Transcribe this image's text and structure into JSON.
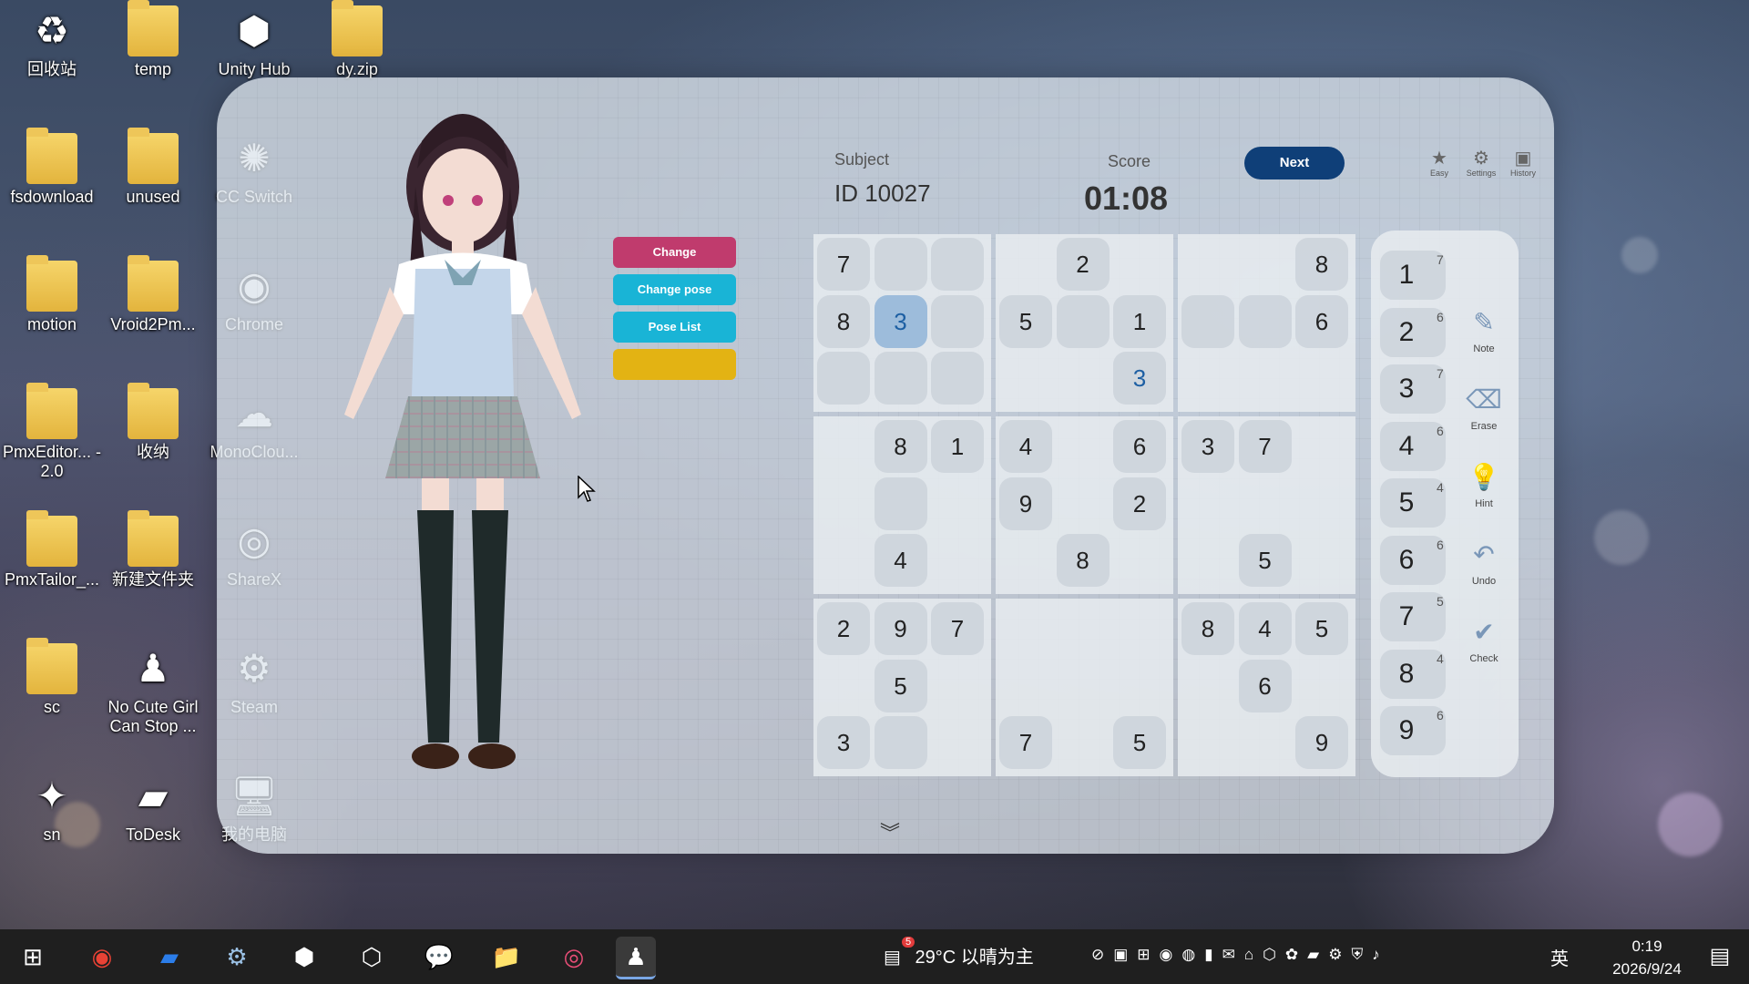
{
  "desktop": {
    "icons": [
      {
        "label": "回收站",
        "icon": "recycle-bin-icon",
        "glyph": "♻"
      },
      {
        "label": "temp",
        "icon": "folder-icon",
        "glyph": ""
      },
      {
        "label": "Unity Hub",
        "icon": "unity-hub-icon",
        "glyph": "⬢"
      },
      {
        "label": "dy.zip",
        "icon": "zip-icon",
        "glyph": ""
      },
      {
        "label": "fsdownload",
        "icon": "folder-icon",
        "glyph": ""
      },
      {
        "label": "unused",
        "icon": "folder-icon",
        "glyph": ""
      },
      {
        "label": "CC Switch",
        "icon": "cc-switch-icon",
        "glyph": "✺"
      },
      {
        "label": "motion",
        "icon": "folder-icon",
        "glyph": ""
      },
      {
        "label": "Vroid2Pm...",
        "icon": "folder-icon",
        "glyph": ""
      },
      {
        "label": "Chrome",
        "icon": "chrome-icon",
        "glyph": "◉"
      },
      {
        "label": "PmxEditor... - 2.0",
        "icon": "folder-icon",
        "glyph": ""
      },
      {
        "label": "收纳",
        "icon": "folder-icon",
        "glyph": ""
      },
      {
        "label": "MonoClou...",
        "icon": "monocloud-icon",
        "glyph": "☁"
      },
      {
        "label": "PmxTailor_...",
        "icon": "folder-icon",
        "glyph": ""
      },
      {
        "label": "新建文件夹",
        "icon": "folder-icon",
        "glyph": ""
      },
      {
        "label": "ShareX",
        "icon": "sharex-icon",
        "glyph": "◎"
      },
      {
        "label": "sc",
        "icon": "folder-icon",
        "glyph": ""
      },
      {
        "label": "No Cute Girl Can Stop ...",
        "icon": "game-icon",
        "glyph": "♟"
      },
      {
        "label": "Steam",
        "icon": "steam-icon",
        "glyph": "⚙"
      },
      {
        "label": "sn",
        "icon": "sn-icon",
        "glyph": "✦"
      },
      {
        "label": "ToDesk",
        "icon": "todesk-icon",
        "glyph": "▰"
      },
      {
        "label": "我的电脑",
        "icon": "computer-icon",
        "glyph": "🖥"
      }
    ]
  },
  "pose_menu": {
    "buttons": [
      {
        "label": "Change",
        "color": "#c03b6d"
      },
      {
        "label": "Change pose",
        "color": "#19b4d6"
      },
      {
        "label": "Pose List",
        "color": "#19b4d6"
      },
      {
        "label": "",
        "color": "#e3b313"
      }
    ]
  },
  "header": {
    "subject_label": "Subject",
    "subject_value": "ID 10027",
    "score_label": "Score",
    "score_value": "01:08",
    "next_label": "Next"
  },
  "top_tools": [
    {
      "label": "Easy",
      "icon": "star-icon"
    },
    {
      "label": "Settings",
      "icon": "gear-icon"
    },
    {
      "label": "History",
      "icon": "history-icon"
    }
  ],
  "grid": [
    [
      "7",
      "",
      "",
      "",
      "2",
      "",
      "",
      "",
      "8"
    ],
    [
      "8",
      "3",
      "",
      "5",
      "",
      "1",
      "",
      "",
      "6"
    ],
    [
      "",
      "",
      "",
      "",
      "",
      "3",
      "",
      "",
      ""
    ],
    [
      "",
      "8",
      "1",
      "4",
      "",
      "6",
      "3",
      "7",
      ""
    ],
    [
      "",
      "",
      "",
      "9",
      "",
      "2",
      "",
      "",
      ""
    ],
    [
      "",
      "4",
      "",
      "",
      "8",
      "",
      "",
      "5",
      ""
    ],
    [
      "2",
      "9",
      "7",
      "",
      "",
      "",
      "8",
      "4",
      "5"
    ],
    [
      "",
      "5",
      "",
      "",
      "",
      "",
      "",
      "6",
      ""
    ],
    [
      "3",
      "",
      "",
      "7",
      "",
      "5",
      "",
      "",
      "9"
    ]
  ],
  "cell_states": [
    [
      "g",
      "e",
      "e",
      "",
      "g",
      "",
      "",
      "",
      "g"
    ],
    [
      "g",
      "s",
      "e",
      "g",
      "e",
      "g",
      "e",
      "e",
      "g"
    ],
    [
      "e",
      "e",
      "e",
      "",
      "",
      "b",
      "",
      "",
      ""
    ],
    [
      "",
      "g",
      "g",
      "g",
      "",
      "g",
      "g",
      "g",
      ""
    ],
    [
      "",
      "e",
      "",
      "g",
      "",
      "g",
      "",
      "",
      ""
    ],
    [
      "",
      "g",
      "",
      "",
      "g",
      "",
      "",
      "g",
      ""
    ],
    [
      "g",
      "g",
      "g",
      "",
      "",
      "",
      "g",
      "g",
      "g"
    ],
    [
      "",
      "g",
      "",
      "",
      "",
      "",
      "",
      "g",
      ""
    ],
    [
      "g",
      "e",
      "",
      "g",
      "",
      "g",
      "",
      "",
      "g"
    ]
  ],
  "number_pad": [
    {
      "n": "1",
      "c": "7"
    },
    {
      "n": "2",
      "c": "6"
    },
    {
      "n": "3",
      "c": "7"
    },
    {
      "n": "4",
      "c": "6"
    },
    {
      "n": "5",
      "c": "4"
    },
    {
      "n": "6",
      "c": "6"
    },
    {
      "n": "7",
      "c": "5"
    },
    {
      "n": "8",
      "c": "4"
    },
    {
      "n": "9",
      "c": "6"
    }
  ],
  "side_tools": [
    {
      "label": "Note",
      "icon": "note-icon"
    },
    {
      "label": "Erase",
      "icon": "eraser-icon"
    },
    {
      "label": "Hint",
      "icon": "lightbulb-icon"
    },
    {
      "label": "Undo",
      "icon": "undo-icon"
    },
    {
      "label": "Check",
      "icon": "check-icon"
    }
  ],
  "taskbar": {
    "weather": "29°C 以晴为主",
    "weather_badge": "5",
    "ime": "英",
    "time": "0:19",
    "date": "2026/9/24"
  }
}
